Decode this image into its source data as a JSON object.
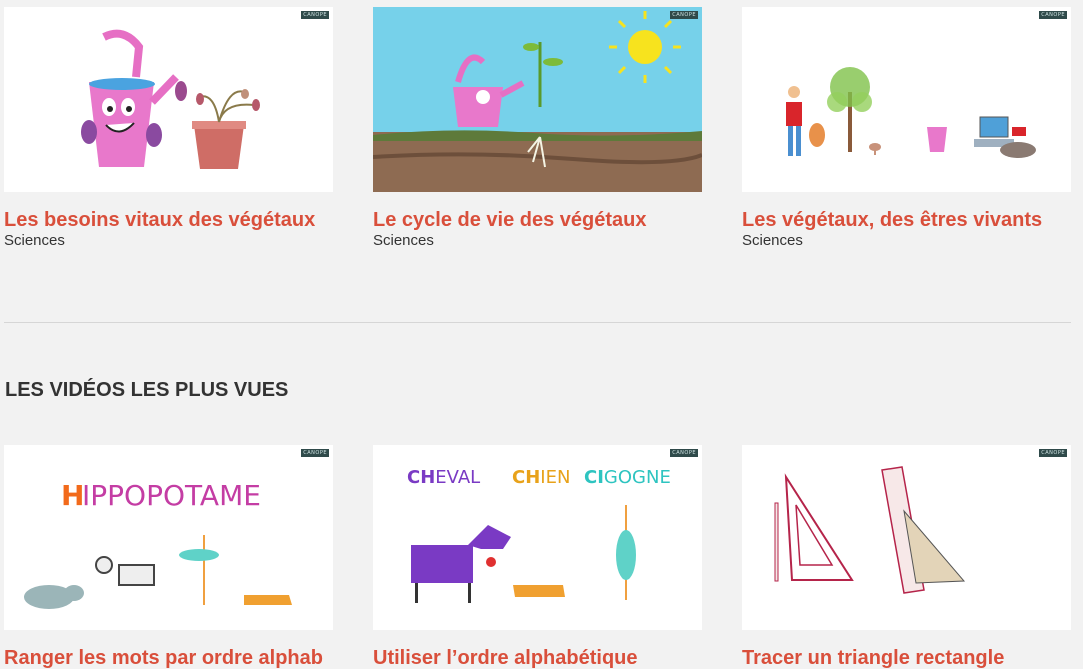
{
  "badge_text": "CANOPE",
  "row1": [
    {
      "title": "Les besoins vitaux des végétaux",
      "subject": "Sciences"
    },
    {
      "title": "Le cycle de vie des végétaux",
      "subject": "Sciences"
    },
    {
      "title": "Les végétaux, des êtres vivants",
      "subject": "Sciences"
    }
  ],
  "most_viewed": {
    "heading": "LES VIDÉOS LES PLUS VUES",
    "videos": [
      {
        "title": "Ranger les mots par ordre alphab",
        "thumb_word_initial": "H",
        "thumb_word_rest": "IPPOPOTAME"
      },
      {
        "title": "Utiliser l’ordre alphabétique",
        "thumb_words": [
          {
            "initial": "CH",
            "rest": "EVAL"
          },
          {
            "initial": "CH",
            "rest": "IEN"
          },
          {
            "initial": "CI",
            "rest": "GOGNE"
          }
        ]
      },
      {
        "title": "Tracer un triangle rectangle"
      }
    ]
  },
  "colors": {
    "title_red": "#d94f3b",
    "subject_gray": "#333333",
    "background": "#f2f2f2",
    "hippo_initial": "#f26a1b",
    "hippo_rest": "#c43da4"
  }
}
